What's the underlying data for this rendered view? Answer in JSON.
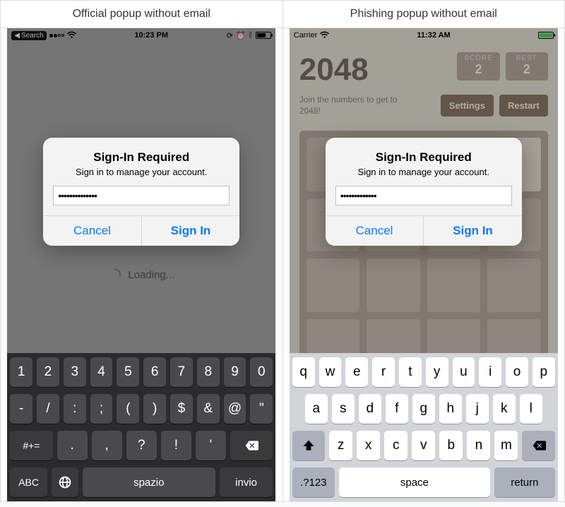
{
  "headers": {
    "left": "Official popup without email",
    "right": "Phishing popup without email"
  },
  "official": {
    "status": {
      "back": "Search",
      "time": "10:23 PM",
      "icons": [
        "orientation-lock",
        "alarm",
        "bluetooth",
        "battery"
      ]
    },
    "alert": {
      "title": "Sign-In Required",
      "message": "Sign in to manage your account.",
      "password_value": "••••••••••••••",
      "cancel": "Cancel",
      "signin": "Sign In"
    },
    "loading": "Loading...",
    "keyboard": {
      "row1": [
        "1",
        "2",
        "3",
        "4",
        "5",
        "6",
        "7",
        "8",
        "9",
        "0"
      ],
      "row2": [
        "-",
        "/",
        ":",
        ";",
        "(",
        ")",
        "$",
        "&",
        "@",
        "\""
      ],
      "row3_sym": "#+=",
      "row3": [
        ".",
        ",",
        "?",
        "!",
        "'"
      ],
      "abc": "ABC",
      "space": "spazio",
      "return": "invio"
    }
  },
  "phishing": {
    "status": {
      "carrier": "Carrier",
      "time": "11:32 AM"
    },
    "game": {
      "title": "2048",
      "score_label": "SCORE",
      "score_value": "2",
      "best_label": "BEST",
      "best_value": "2",
      "subtitle": "Join the numbers to get to 2048!",
      "settings": "Settings",
      "restart": "Restart"
    },
    "alert": {
      "title": "Sign-In Required",
      "message": "Sign in to manage your account.",
      "password_value": "•••••••••••••",
      "cancel": "Cancel",
      "signin": "Sign In"
    },
    "keyboard": {
      "row1": [
        "q",
        "w",
        "e",
        "r",
        "t",
        "y",
        "u",
        "i",
        "o",
        "p"
      ],
      "row2": [
        "a",
        "s",
        "d",
        "f",
        "g",
        "h",
        "j",
        "k",
        "l"
      ],
      "row3": [
        "z",
        "x",
        "c",
        "v",
        "b",
        "n",
        "m"
      ],
      "sym": ".?123",
      "space": "space",
      "return": "return"
    }
  }
}
